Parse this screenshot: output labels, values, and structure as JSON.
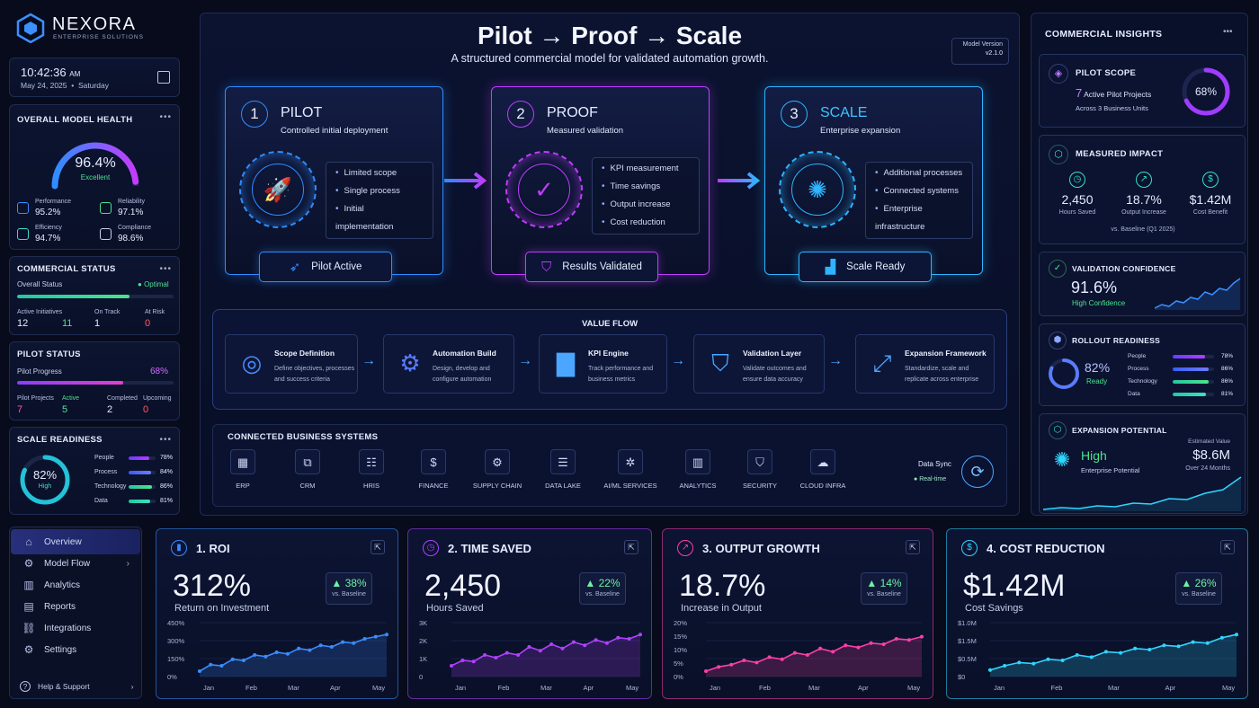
{
  "brand": {
    "name": "NEXORA",
    "tagline": "ENTERPRISE SOLUTIONS"
  },
  "clock": {
    "time": "10:42:36",
    "ampm": "AM",
    "date": "May 24, 2025",
    "weekday": "Saturday"
  },
  "health": {
    "title": "OVERALL MODEL HEALTH",
    "value": "96.4%",
    "status": "Excellent",
    "level": 0.964,
    "metrics": [
      {
        "label": "Performance",
        "value": "95.2%"
      },
      {
        "label": "Reliability",
        "value": "97.1%"
      },
      {
        "label": "Efficiency",
        "value": "94.7%"
      },
      {
        "label": "Compliance",
        "value": "98.6%"
      }
    ]
  },
  "commercial": {
    "title": "COMMERCIAL STATUS",
    "overall_label": "Overall Status",
    "overall_value": "Optimal",
    "level": 0.72,
    "cols": [
      {
        "label": "Active Initiatives",
        "value": "12"
      },
      {
        "label": "",
        "value": "11"
      },
      {
        "label": "On Track",
        "value": "1"
      },
      {
        "label": "At Risk",
        "value": "0"
      }
    ]
  },
  "pilot": {
    "title": "PILOT STATUS",
    "progress_label": "Pilot Progress",
    "progress_value": "68%",
    "level": 0.68,
    "cols": [
      {
        "label": "Pilot Projects",
        "value": "7"
      },
      {
        "label": "Active",
        "value": "5"
      },
      {
        "label": "Completed",
        "value": "2"
      },
      {
        "label": "Upcoming",
        "value": "0"
      }
    ]
  },
  "scale_readiness": {
    "title": "SCALE READINESS",
    "value": "82%",
    "status": "High",
    "level": 0.82,
    "items": [
      {
        "label": "People",
        "value": "78%",
        "level": 0.78
      },
      {
        "label": "Process",
        "value": "84%",
        "level": 0.84
      },
      {
        "label": "Technology",
        "value": "86%",
        "level": 0.86
      },
      {
        "label": "Data",
        "value": "81%",
        "level": 0.81
      }
    ]
  },
  "nav": {
    "items": [
      {
        "label": "Overview",
        "icon": "home-icon"
      },
      {
        "label": "Model Flow",
        "icon": "flow-icon"
      },
      {
        "label": "Analytics",
        "icon": "analytics-icon"
      },
      {
        "label": "Reports",
        "icon": "reports-icon"
      },
      {
        "label": "Integrations",
        "icon": "integrations-icon"
      },
      {
        "label": "Settings",
        "icon": "gear-icon"
      }
    ],
    "help": "Help & Support"
  },
  "hero": {
    "title": "Pilot → Proof → Scale",
    "subtitle": "A structured commercial model for validated automation growth.",
    "version_label": "Model Version",
    "version": "v2.1.0"
  },
  "stages": [
    {
      "num": "1",
      "name": "PILOT",
      "desc": "Controlled initial deployment",
      "items": [
        "Limited scope",
        "Single process",
        "Initial implementation"
      ],
      "badge": "Pilot Active",
      "color": "#2f8dff"
    },
    {
      "num": "2",
      "name": "PROOF",
      "desc": "Measured validation",
      "items": [
        "KPI measurement",
        "Time savings",
        "Output increase",
        "Cost reduction"
      ],
      "badge": "Results Validated",
      "color": "#c03cff"
    },
    {
      "num": "3",
      "name": "SCALE",
      "desc": "Enterprise expansion",
      "items": [
        "Additional processes",
        "Connected systems",
        "Enterprise infrastructure"
      ],
      "badge": "Scale Ready",
      "color": "#2fb4ff"
    }
  ],
  "value_flow": {
    "title": "VALUE FLOW",
    "steps": [
      {
        "title": "Scope Definition",
        "desc1": "Define objectives, processes",
        "desc2": "and success criteria"
      },
      {
        "title": "Automation Build",
        "desc1": "Design, develop and",
        "desc2": "configure automation"
      },
      {
        "title": "KPI Engine",
        "desc1": "Track performance and",
        "desc2": "business metrics"
      },
      {
        "title": "Validation Layer",
        "desc1": "Validate outcomes and",
        "desc2": "ensure data accuracy"
      },
      {
        "title": "Expansion Framework",
        "desc1": "Standardize, scale and",
        "desc2": "replicate across enterprise"
      }
    ]
  },
  "systems": {
    "title": "CONNECTED BUSINESS SYSTEMS",
    "items": [
      "ERP",
      "CRM",
      "HRIS",
      "FINANCE",
      "SUPPLY CHAIN",
      "DATA LAKE",
      "AI/ML SERVICES",
      "ANALYTICS",
      "SECURITY",
      "CLOUD INFRA"
    ],
    "sync_label": "Data Sync",
    "sync_status": "Real-time"
  },
  "insights": {
    "title": "COMMERCIAL INSIGHTS",
    "pilot_scope": {
      "title": "PILOT SCOPE",
      "count": "7",
      "count_label": "Active Pilot Projects",
      "sub": "Across 3 Business Units",
      "value": "68%",
      "level": 0.68
    },
    "impact": {
      "title": "MEASURED IMPACT",
      "items": [
        {
          "value": "2,450",
          "label": "Hours Saved",
          "icon": "clock-icon"
        },
        {
          "value": "18.7%",
          "label": "Output Increase",
          "icon": "trend-icon"
        },
        {
          "value": "$1.42M",
          "label": "Cost Benefit",
          "icon": "dollar-icon"
        }
      ],
      "baseline": "vs. Baseline (Q1 2025)"
    },
    "confidence": {
      "title": "VALIDATION CONFIDENCE",
      "value": "91.6%",
      "status": "High Confidence"
    },
    "rollout": {
      "title": "ROLLOUT READINESS",
      "value": "82%",
      "status": "Ready",
      "level": 0.82,
      "items": [
        {
          "label": "People",
          "value": "78%",
          "level": 0.78
        },
        {
          "label": "Process",
          "value": "86%",
          "level": 0.86
        },
        {
          "label": "Technology",
          "value": "86%",
          "level": 0.86
        },
        {
          "label": "Data",
          "value": "81%",
          "level": 0.81
        }
      ]
    },
    "expansion": {
      "title": "EXPANSION POTENTIAL",
      "level_text": "High",
      "level_label": "Enterprise Potential",
      "est_label": "Estimated Value",
      "est_value": "$8.6M",
      "est_period": "Over 24 Months"
    }
  },
  "kpis": [
    {
      "title": "1. ROI",
      "value": "312%",
      "sub": "Return on Investment",
      "delta": "▲ 38%",
      "baseline": "vs. Baseline",
      "color": "#3a8cff",
      "yticks": [
        "450%",
        "300%",
        "150%",
        "0%"
      ],
      "months": [
        "Jan",
        "Feb",
        "Mar",
        "Apr",
        "May"
      ]
    },
    {
      "title": "2. TIME SAVED",
      "value": "2,450",
      "sub": "Hours Saved",
      "delta": "▲ 22%",
      "baseline": "vs. Baseline",
      "color": "#b240ff",
      "yticks": [
        "3K",
        "2K",
        "1K",
        "0"
      ],
      "months": [
        "Jan",
        "Feb",
        "Mar",
        "Apr",
        "May"
      ]
    },
    {
      "title": "3. OUTPUT GROWTH",
      "value": "18.7%",
      "sub": "Increase in Output",
      "delta": "▲ 14%",
      "baseline": "vs. Baseline",
      "color": "#ff3fa8",
      "yticks": [
        "20%",
        "15%",
        "10%",
        "5%",
        "0%"
      ],
      "months": [
        "Jan",
        "Feb",
        "Mar",
        "Apr",
        "May"
      ]
    },
    {
      "title": "4. COST REDUCTION",
      "value": "$1.42M",
      "sub": "Cost Savings",
      "delta": "▲ 26%",
      "baseline": "vs. Baseline",
      "color": "#2fd6ff",
      "yticks": [
        "$1.0M",
        "$1.5M",
        "$0.5M",
        "$0"
      ],
      "months": [
        "Jan",
        "Feb",
        "Mar",
        "Apr",
        "May"
      ]
    }
  ]
}
